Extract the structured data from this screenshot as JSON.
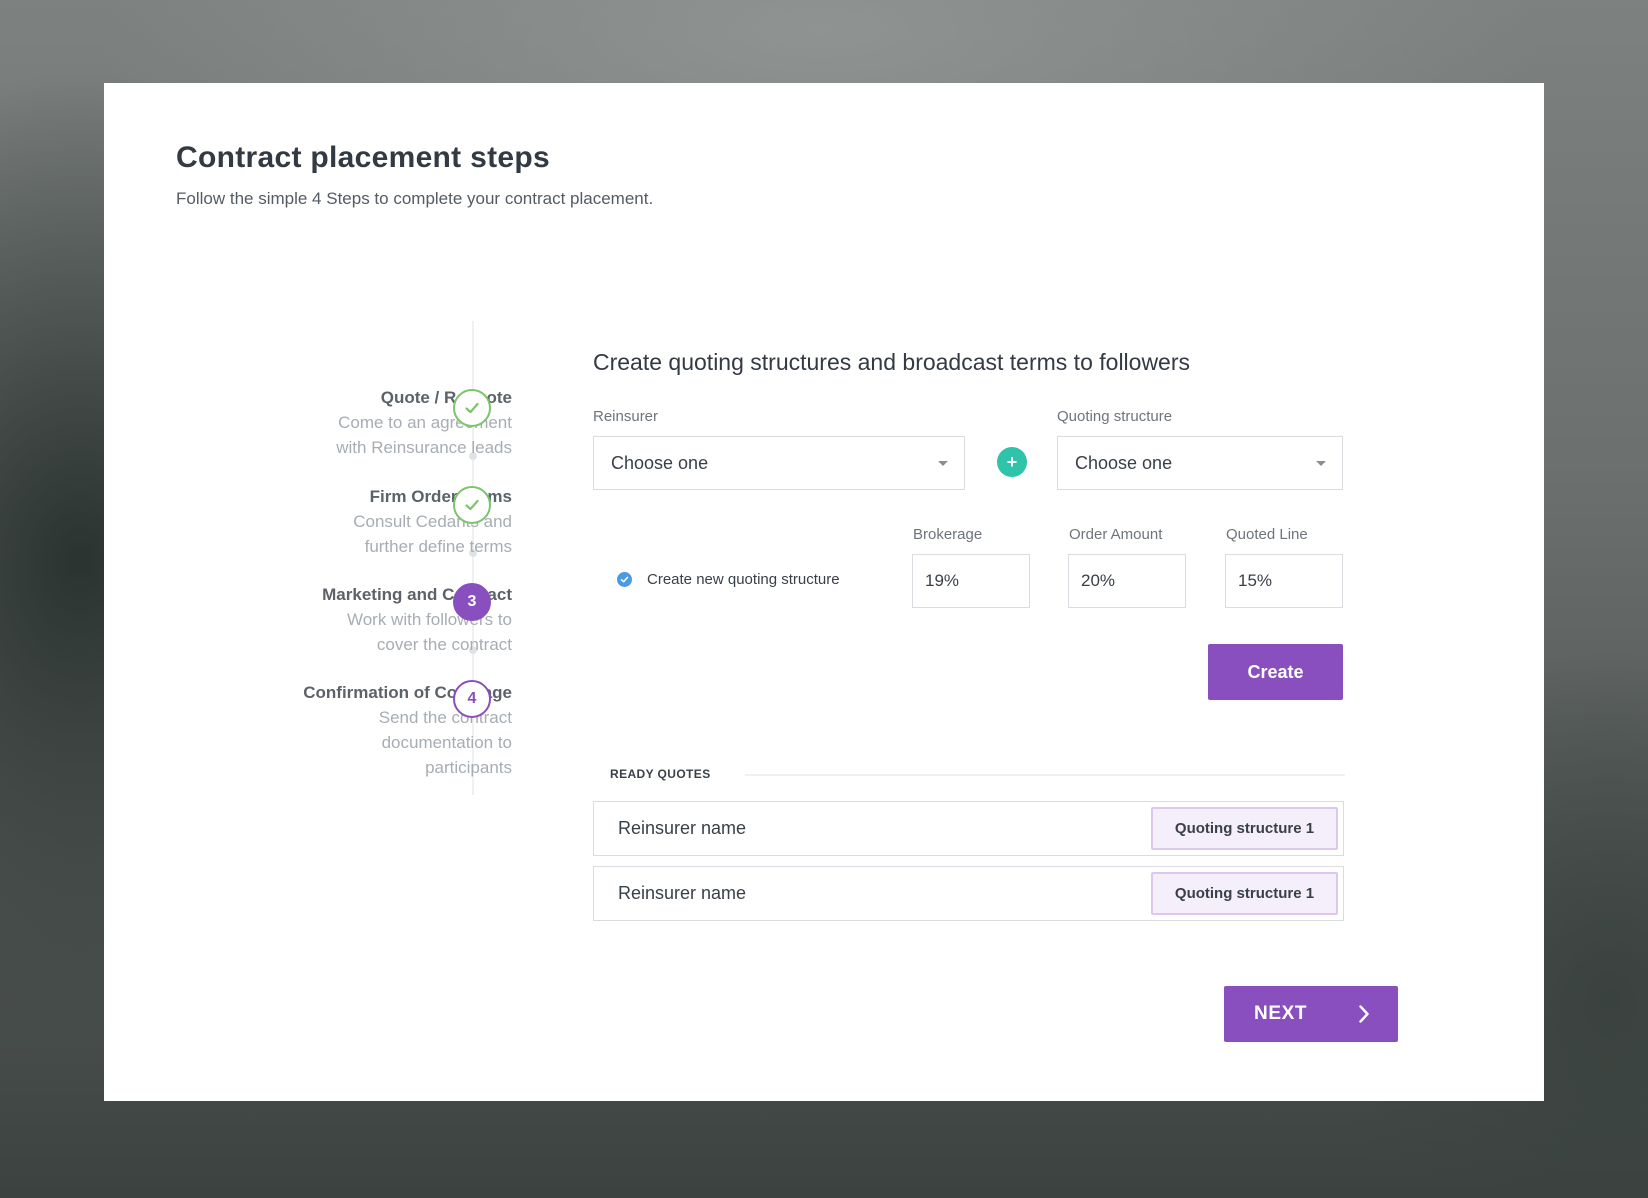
{
  "header": {
    "title": "Contract placement steps",
    "subtitle": "Follow the simple 4 Steps to complete your contract placement."
  },
  "steps": [
    {
      "title": "Quote  / Requote",
      "desc1": "Come to an agreement",
      "desc2": "with Reinsurance leads",
      "desc3": "",
      "desc4": "",
      "marker": "",
      "status": "done"
    },
    {
      "title": "Firm Order Terms",
      "desc1": "Consult Cedants and",
      "desc2": "further define terms",
      "desc3": "",
      "desc4": "",
      "marker": "",
      "status": "done"
    },
    {
      "title": "Marketing and Contract",
      "desc1": "Work with followers to",
      "desc2": "cover the contract",
      "desc3": "",
      "desc4": "",
      "marker": "3",
      "status": "active"
    },
    {
      "title": "Confirmation of Coverage",
      "desc1": "Send the contract",
      "desc2": "documentation to",
      "desc3": "participants",
      "desc4": "",
      "marker": "4",
      "status": "todo"
    }
  ],
  "form": {
    "section_title": "Create quoting structures and broadcast terms to followers",
    "reinsurer_label": "Reinsurer",
    "reinsurer_value": "Choose one",
    "quoting_label": "Quoting structure",
    "quoting_value": "Choose one",
    "add_button": "+",
    "new_structure_label": "Create new quoting structure",
    "brokerage_label": "Brokerage",
    "brokerage_value": "19%",
    "order_amount_label": "Order Amount",
    "order_amount_value": "20%",
    "quoted_line_label": "Quoted Line",
    "quoted_line_value": "15%",
    "create_button": "Create"
  },
  "ready_quotes": {
    "label": "READY QUOTES",
    "rows": [
      {
        "name": "Reinsurer name",
        "structure": "Quoting structure 1"
      },
      {
        "name": "Reinsurer name",
        "structure": "Quoting structure 1"
      }
    ]
  },
  "footer": {
    "next_label": "NEXT"
  },
  "colors": {
    "primary": "#8a4fbe",
    "success": "#7cc46a",
    "teal": "#2fc3a9",
    "radio": "#4b9be3"
  }
}
